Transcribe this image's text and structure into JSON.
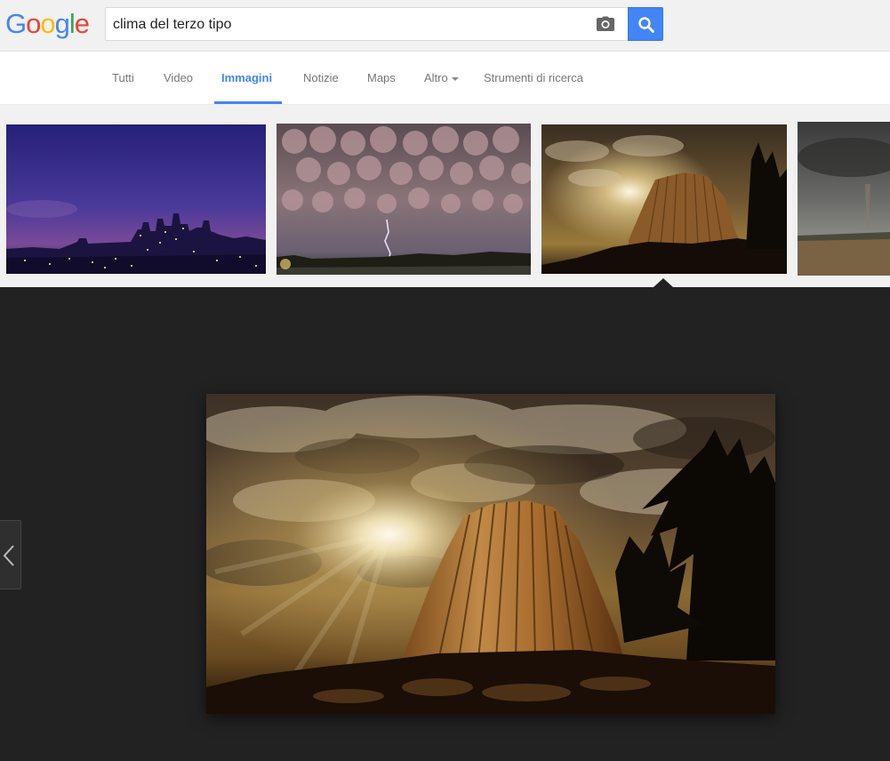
{
  "logo": {
    "letters": [
      "G",
      "o",
      "o",
      "g",
      "l",
      "e"
    ],
    "colors": [
      "#4285f4",
      "#ea4335",
      "#fbbc05",
      "#4285f4",
      "#34a853",
      "#ea4335"
    ]
  },
  "search": {
    "query": "clima del terzo tipo",
    "camera_icon": "camera-icon",
    "search_icon": "search-icon"
  },
  "nav": {
    "tabs": [
      "Tutti",
      "Video",
      "Immagini",
      "Notizie",
      "Maps",
      "Altro",
      "Strumenti di ricerca"
    ],
    "active": "Immagini"
  },
  "thumbnails": [
    {
      "subject": "city skyline at dusk"
    },
    {
      "subject": "mammatus clouds with lightning"
    },
    {
      "subject": "Devils Tower with sun rays"
    },
    {
      "subject": "storm over plains"
    }
  ],
  "viewer": {
    "prev_icon": "chevron-left-icon",
    "selected": 2
  },
  "colors": {
    "accent": "#4285f4",
    "strip_bg": "#f1f1f1",
    "viewer_bg": "#222222"
  }
}
